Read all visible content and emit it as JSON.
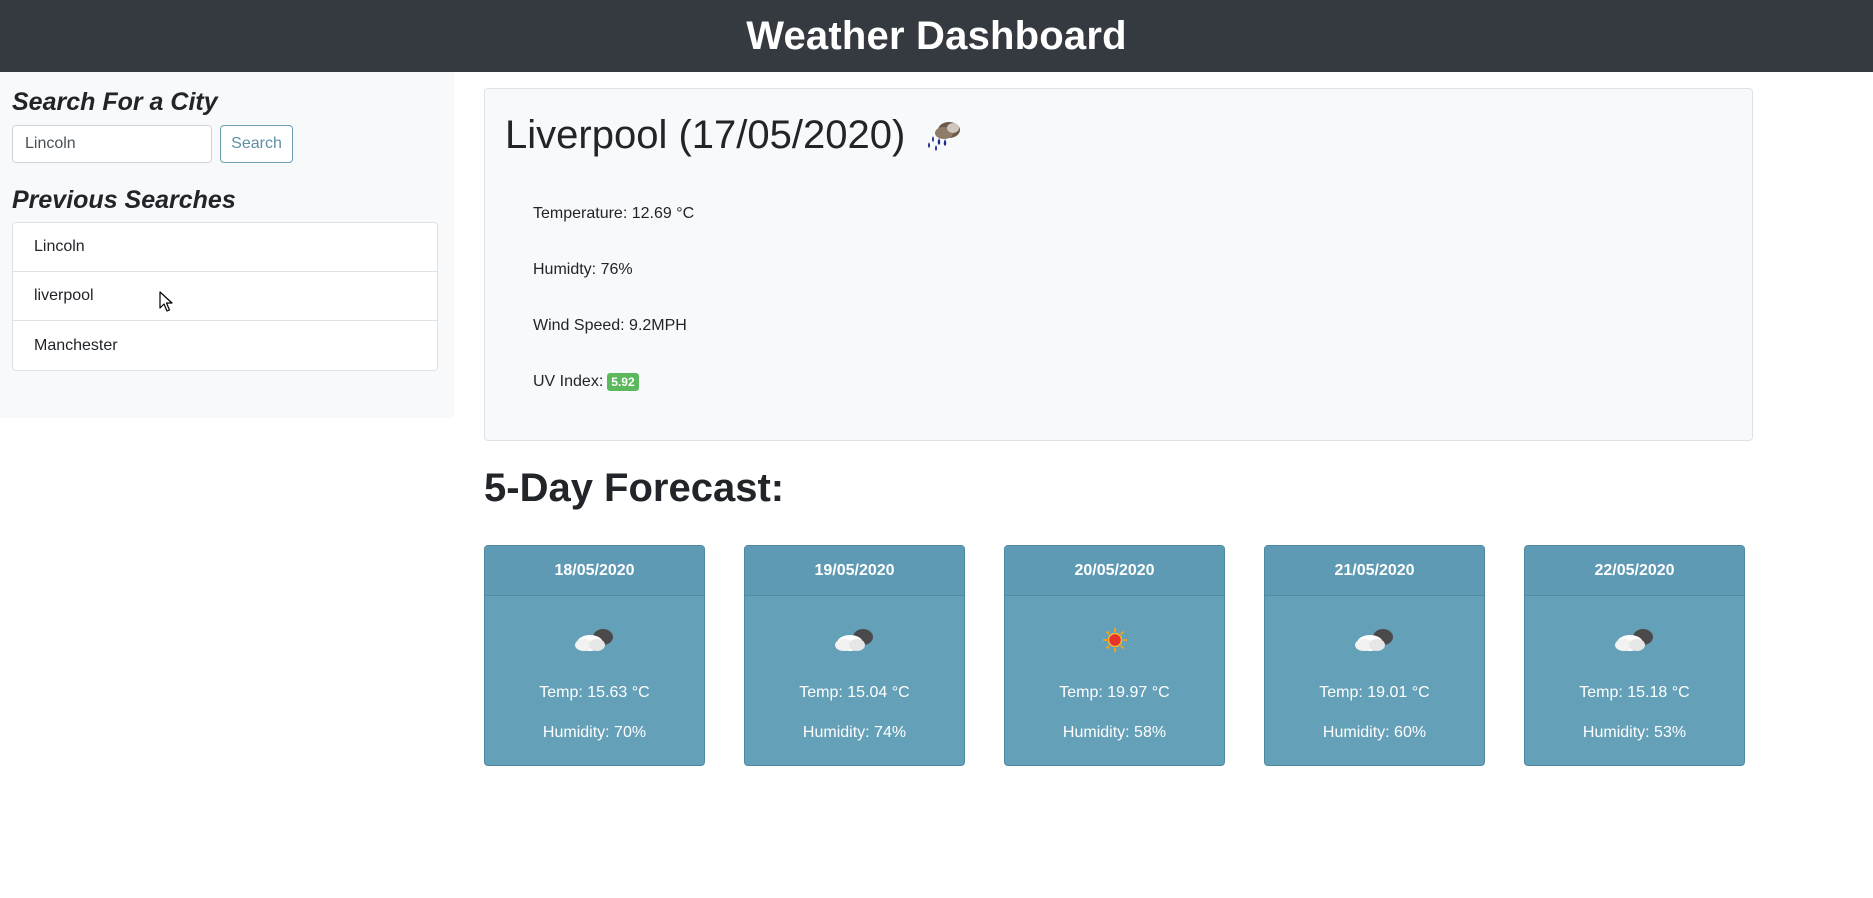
{
  "header": {
    "title": "Weather Dashboard"
  },
  "sidebar": {
    "search_heading": "Search For a City",
    "search_value": "Lincoln",
    "search_button": "Search",
    "previous_heading": "Previous Searches",
    "previous_items": [
      "Lincoln",
      "liverpool",
      "Manchester"
    ]
  },
  "current": {
    "title": "Liverpool (17/05/2020)",
    "icon": "rain-cloud-icon",
    "temperature": "Temperature: 12.69 °C",
    "humidity": "Humidty: 76%",
    "wind": "Wind Speed: 9.2MPH",
    "uv_label": "UV Index:",
    "uv_value": "5.92",
    "uv_color": "#5cb85c"
  },
  "forecast": {
    "title": "5-Day Forecast:",
    "days": [
      {
        "date": "18/05/2020",
        "icon": "cloud-icon",
        "temp": "Temp: 15.63 °C",
        "humidity": "Humidity: 70%"
      },
      {
        "date": "19/05/2020",
        "icon": "cloud-icon",
        "temp": "Temp: 15.04 °C",
        "humidity": "Humidity: 74%"
      },
      {
        "date": "20/05/2020",
        "icon": "sun-icon",
        "temp": "Temp: 19.97 °C",
        "humidity": "Humidity: 58%"
      },
      {
        "date": "21/05/2020",
        "icon": "cloud-icon",
        "temp": "Temp: 19.01 °C",
        "humidity": "Humidity: 60%"
      },
      {
        "date": "22/05/2020",
        "icon": "cloud-icon",
        "temp": "Temp: 15.18 °C",
        "humidity": "Humidity: 53%"
      }
    ],
    "card_color": "#64a0b8"
  }
}
